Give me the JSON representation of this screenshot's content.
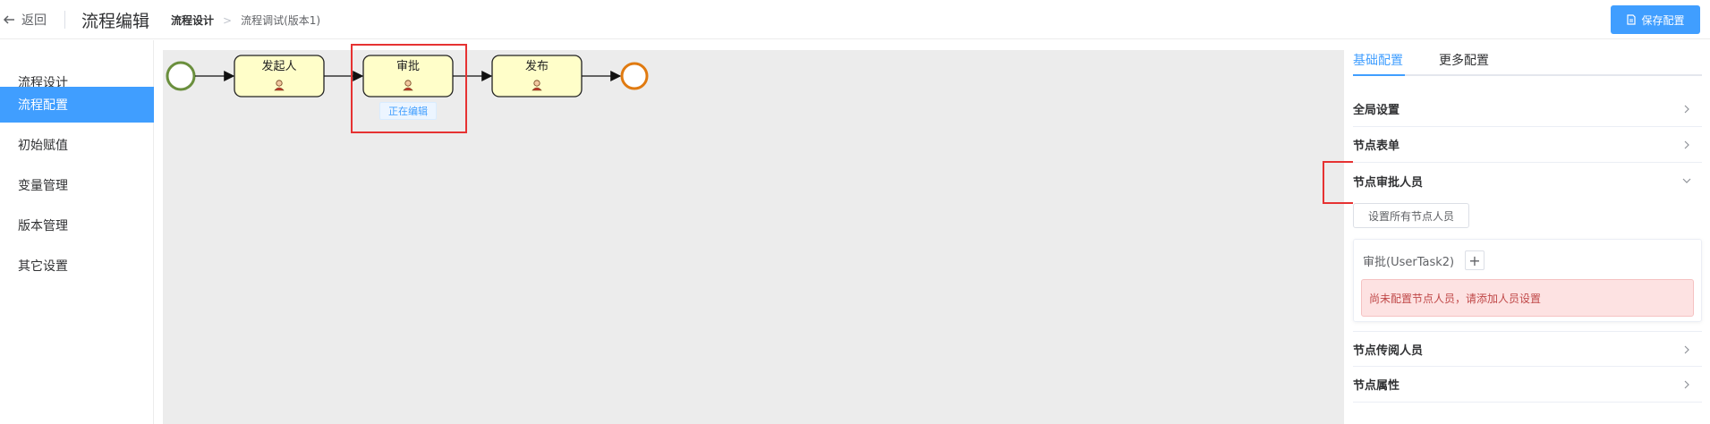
{
  "header": {
    "back_label": "返回",
    "title": "流程编辑",
    "breadcrumb": [
      "流程设计",
      ">",
      "流程调试(版本1)"
    ],
    "save_label": "保存配置"
  },
  "sidebar": {
    "items": [
      {
        "label": "流程设计",
        "active": false
      },
      {
        "label": "流程配置",
        "active": true
      },
      {
        "label": "初始赋值",
        "active": false
      },
      {
        "label": "变量管理",
        "active": false
      },
      {
        "label": "版本管理",
        "active": false
      },
      {
        "label": "其它设置",
        "active": false
      }
    ]
  },
  "diagram": {
    "tasks": [
      {
        "label": "发起人",
        "icon": "user-icon"
      },
      {
        "label": "审批",
        "icon": "user-icon"
      },
      {
        "label": "发布",
        "icon": "user-icon"
      }
    ],
    "editing_tag": "正在编辑",
    "colors": {
      "start": "#6a8f3d",
      "end": "#e07a10",
      "task_fill": "#fffec9",
      "canvas": "#ececec"
    }
  },
  "panel": {
    "tabs": [
      {
        "label": "基础配置",
        "active": true
      },
      {
        "label": "更多配置",
        "active": false
      }
    ],
    "sections": {
      "global": "全局设置",
      "form": "节点表单",
      "approvers": "节点审批人员",
      "cc": "节点传阅人员",
      "props": "节点属性"
    },
    "set_all_label": "设置所有节点人员",
    "node_title": "审批(UserTask2)",
    "add_symbol": "+",
    "warning": "尚未配置节点人员，请添加人员设置"
  },
  "colors": {
    "accent": "#409eff",
    "highlight": "#e63232",
    "warning_bg": "#fde2e2"
  }
}
